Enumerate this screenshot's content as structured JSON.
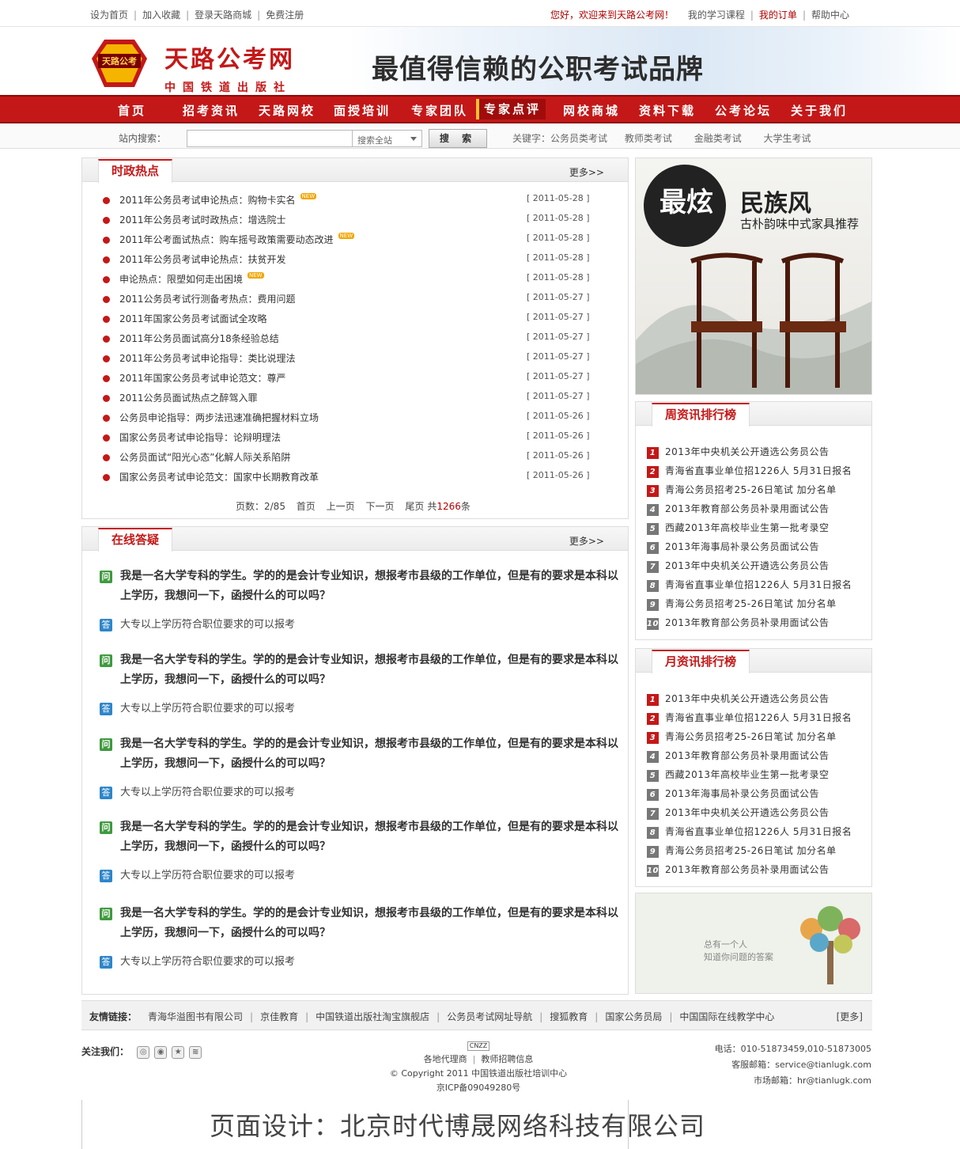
{
  "topbar": {
    "left": [
      "设为首页",
      "加入收藏",
      "登录天路商城",
      "免费注册"
    ],
    "welcome": "您好，欢迎来到天路公考网！",
    "right": [
      "我的学习课程",
      "我的订单",
      "帮助中心"
    ]
  },
  "header": {
    "badge": "天路公考",
    "site_name": "天路公考网",
    "publisher": "中国铁道出版社",
    "slogan": "最值得信赖的公职考试品牌"
  },
  "nav": [
    "首页",
    "招考资讯",
    "天路网校",
    "面授培训",
    "专家团队",
    "专家点评",
    "网校商城",
    "资料下载",
    "公考论坛",
    "关于我们"
  ],
  "search": {
    "label": "站内搜索：",
    "scope": "搜索全站",
    "button": "搜 索",
    "keyword_label": "关键字：",
    "keywords": [
      "公务员类考试",
      "教师类考试",
      "金融类考试",
      "大学生考试"
    ]
  },
  "hot": {
    "title": "时政热点",
    "more": "更多>>",
    "new_badge": "NEW",
    "items": [
      {
        "text": "2011年公务员考试申论热点：购物卡实名",
        "date": "[ 2011-05-28 ]",
        "new": true
      },
      {
        "text": "2011年公务员考试时政热点：增选院士",
        "date": "[ 2011-05-28 ]",
        "new": false
      },
      {
        "text": "2011年公考面试热点：购车摇号政策需要动态改进",
        "date": "[ 2011-05-28 ]",
        "new": true
      },
      {
        "text": "2011年公务员考试申论热点：扶贫开发",
        "date": "[ 2011-05-28 ]",
        "new": false
      },
      {
        "text": "申论热点：限塑如何走出困境",
        "date": "[ 2011-05-28 ]",
        "new": true
      },
      {
        "text": "2011公务员考试行测备考热点：费用问题",
        "date": "[ 2011-05-27 ]",
        "new": false
      },
      {
        "text": "2011年国家公务员考试面试全攻略",
        "date": "[ 2011-05-27 ]",
        "new": false
      },
      {
        "text": "2011年公务员面试高分18条经验总结",
        "date": "[ 2011-05-27 ]",
        "new": false
      },
      {
        "text": "2011年公务员考试申论指导：类比说理法",
        "date": "[ 2011-05-27 ]",
        "new": false
      },
      {
        "text": "2011年国家公务员考试申论范文：尊严",
        "date": "[ 2011-05-27 ]",
        "new": false
      },
      {
        "text": "2011公务员面试热点之醉驾入罪",
        "date": "[ 2011-05-27 ]",
        "new": false
      },
      {
        "text": "公务员申论指导：两步法迅速准确把握材料立场",
        "date": "[ 2011-05-26 ]",
        "new": false
      },
      {
        "text": "国家公务员考试申论指导：论辩明理法",
        "date": "[ 2011-05-26 ]",
        "new": false
      },
      {
        "text": "公务员面试“阳光心态”化解人际关系陷阱",
        "date": "[ 2011-05-26 ]",
        "new": false
      },
      {
        "text": "国家公务员考试申论范文：国家中长期教育改革",
        "date": "[ 2011-05-26 ]",
        "new": false
      }
    ],
    "pager": {
      "pages": "页数：2/85",
      "first": "首页",
      "prev": "上一页",
      "next": "下一页",
      "last": "尾页",
      "total_prefix": "共",
      "total": "1266",
      "total_suffix": "条"
    }
  },
  "qa": {
    "title": "在线答疑",
    "more": "更多>>",
    "q_icon": "问",
    "a_icon": "答",
    "items": [
      {
        "q": "我是一名大学专科的学生。学的的是会计专业知识，想报考市县级的工作单位，但是有的要求是本科以上学历，我想问一下，函授什么的可以吗？",
        "a": "大专以上学历符合职位要求的可以报考"
      },
      {
        "q": "我是一名大学专科的学生。学的的是会计专业知识，想报考市县级的工作单位，但是有的要求是本科以上学历，我想问一下，函授什么的可以吗？",
        "a": "大专以上学历符合职位要求的可以报考"
      },
      {
        "q": "我是一名大学专科的学生。学的的是会计专业知识，想报考市县级的工作单位，但是有的要求是本科以上学历，我想问一下，函授什么的可以吗？",
        "a": "大专以上学历符合职位要求的可以报考"
      },
      {
        "q": "我是一名大学专科的学生。学的的是会计专业知识，想报考市县级的工作单位，但是有的要求是本科以上学历，我想问一下，函授什么的可以吗？",
        "a": "大专以上学历符合职位要求的可以报考"
      },
      {
        "q": "我是一名大学专科的学生。学的的是会计专业知识，想报考市县级的工作单位，但是有的要求是本科以上学历，我想问一下，函授什么的可以吗？",
        "a": "大专以上学历符合职位要求的可以报考"
      }
    ]
  },
  "ad": {
    "big": "最炫",
    "title": "民族风",
    "sub": "古朴韵味中式家具推荐"
  },
  "weekly": {
    "title": "周资讯排行榜",
    "items": [
      "2013年中央机关公开遴选公务员公告",
      "青海省直事业单位招1226人 5月31日报名",
      "青海公务员招考25-26日笔试 加分名单",
      "2013年教育部公务员补录用面试公告",
      "西藏2013年高校毕业生第一批考录空",
      "2013年海事局补录公务员面试公告",
      "2013年中央机关公开遴选公务员公告",
      "青海省直事业单位招1226人 5月31日报名",
      "青海公务员招考25-26日笔试 加分名单",
      "2013年教育部公务员补录用面试公告"
    ]
  },
  "monthly": {
    "title": "月资讯排行榜",
    "items": [
      "2013年中央机关公开遴选公务员公告",
      "青海省直事业单位招1226人 5月31日报名",
      "青海公务员招考25-26日笔试 加分名单",
      "2013年教育部公务员补录用面试公告",
      "西藏2013年高校毕业生第一批考录空",
      "2013年海事局补录公务员面试公告",
      "2013年中央机关公开遴选公务员公告",
      "青海省直事业单位招1226人 5月31日报名",
      "青海公务员招考25-26日笔试 加分名单",
      "2013年教育部公务员补录用面试公告"
    ]
  },
  "tree_ad": {
    "line1": "总有一个人",
    "line2": "知道你问题的答案"
  },
  "friends": {
    "label": "友情链接：",
    "links": [
      "青海华溢图书有限公司",
      "京佳教育",
      "中国铁道出版社淘宝旗舰店",
      "公务员考试网址导航",
      "搜狐教育",
      "国家公务员局",
      "中国国际在线教学中心"
    ],
    "more": "[更多]"
  },
  "footer": {
    "follow": "关注我们：",
    "cnzz": "CNZZ",
    "links": [
      "各地代理商",
      "教师招聘信息"
    ],
    "copyright": "© Copyright 2011 中国铁道出版社培训中心",
    "icp": "京ICP备09049280号",
    "phone": "电话：010-51873459,010-51873005",
    "service_mail": "客服邮箱：service@tianlugk.com",
    "market_mail": "市场邮箱：hr@tianlugk.com"
  },
  "designer": "页面设计：北京时代博晟网络科技有限公司",
  "colors": {
    "brand_red": "#c41818",
    "dark_red": "#8e0a0a",
    "badge_gold": "#f2a500"
  }
}
